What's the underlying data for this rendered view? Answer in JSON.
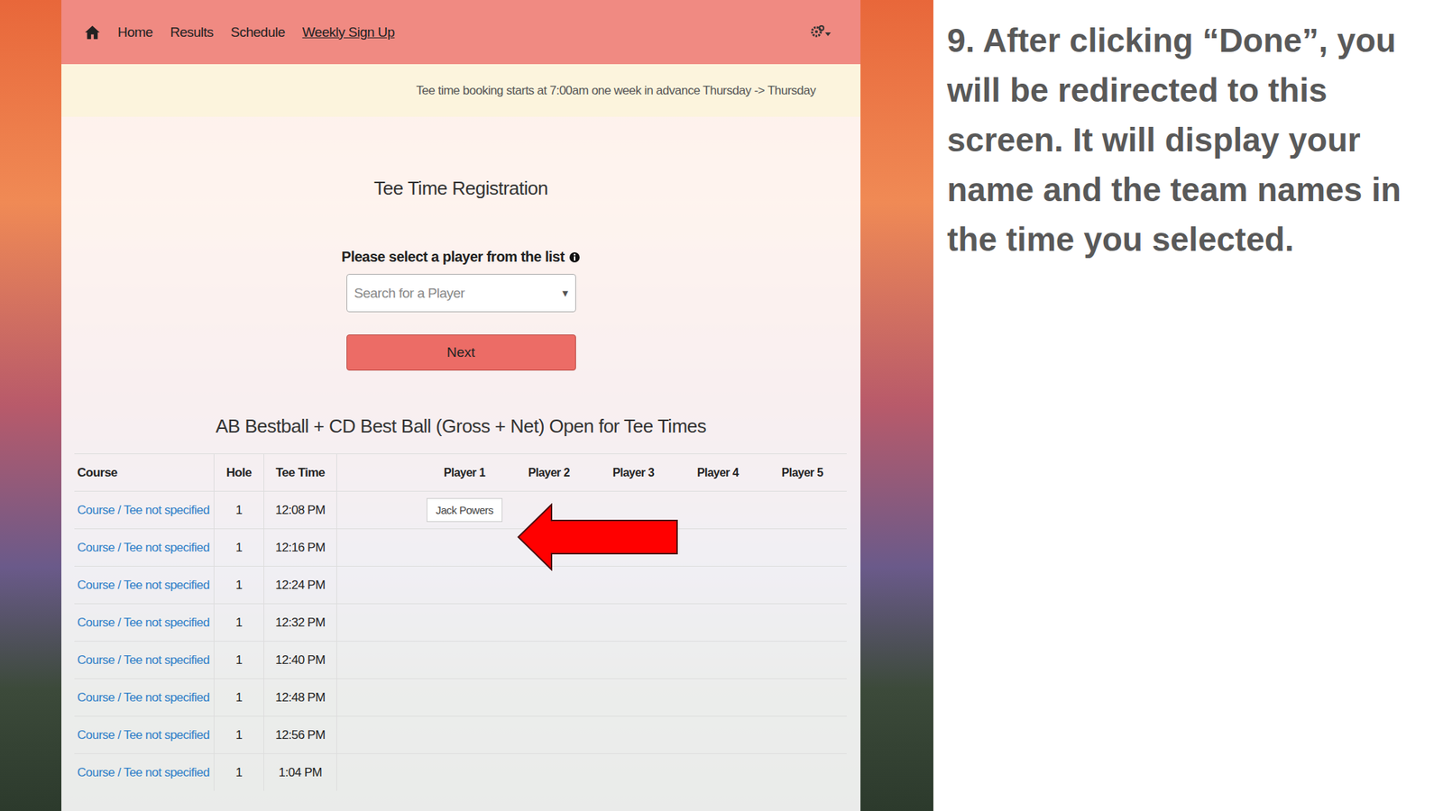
{
  "slide": {
    "instruction": "9. After clicking “Done”, you will be redirected to this screen. It will display your name and the team names in the time you selected."
  },
  "nav": {
    "items": [
      {
        "label": "Home",
        "selected": false
      },
      {
        "label": "Results",
        "selected": false
      },
      {
        "label": "Schedule",
        "selected": false
      },
      {
        "label": "Weekly Sign Up",
        "selected": true
      }
    ]
  },
  "notice": "Tee time booking starts at 7:00am one week in advance Thursday -> Thursday",
  "registration": {
    "title": "Tee Time Registration",
    "prompt": "Please select a player from the list",
    "search_placeholder": "Search for a Player",
    "caret": "▾",
    "next_button": "Next"
  },
  "table": {
    "title": "AB Bestball + CD Best Ball (Gross + Net) Open for Tee Times",
    "columns": [
      "Course",
      "Hole",
      "Tee Time",
      "Player 1",
      "Player 2",
      "Player 3",
      "Player 4",
      "Player 5"
    ],
    "rows": [
      {
        "course": "Course / Tee not specified",
        "hole": "1",
        "time": "12:08 PM",
        "players": [
          "Jack Powers"
        ]
      },
      {
        "course": "Course / Tee not specified",
        "hole": "1",
        "time": "12:16 PM",
        "players": []
      },
      {
        "course": "Course / Tee not specified",
        "hole": "1",
        "time": "12:24 PM",
        "players": []
      },
      {
        "course": "Course / Tee not specified",
        "hole": "1",
        "time": "12:32 PM",
        "players": []
      },
      {
        "course": "Course / Tee not specified",
        "hole": "1",
        "time": "12:40 PM",
        "players": []
      },
      {
        "course": "Course / Tee not specified",
        "hole": "1",
        "time": "12:48 PM",
        "players": []
      },
      {
        "course": "Course / Tee not specified",
        "hole": "1",
        "time": "12:56 PM",
        "players": []
      },
      {
        "course": "Course / Tee not specified",
        "hole": "1",
        "time": "1:04 PM",
        "players": []
      }
    ]
  }
}
